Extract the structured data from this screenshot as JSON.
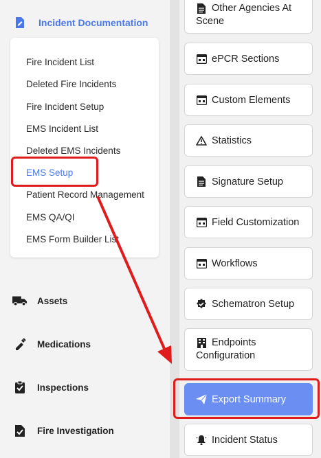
{
  "sidebar": {
    "section": {
      "label": "Incident Documentation",
      "icon": "file-edit-icon"
    },
    "submenu": [
      {
        "label": "Fire Incident List"
      },
      {
        "label": "Deleted Fire Incidents"
      },
      {
        "label": "Fire Incident Setup"
      },
      {
        "label": "EMS Incident List"
      },
      {
        "label": "Deleted EMS Incidents"
      },
      {
        "label": "EMS Setup",
        "active": true
      },
      {
        "label": "Patient Record Management"
      },
      {
        "label": "EMS QA/QI"
      },
      {
        "label": "EMS Form Builder List"
      }
    ],
    "nav": [
      {
        "label": "Assets",
        "icon": "truck-icon"
      },
      {
        "label": "Medications",
        "icon": "syringe-icon"
      },
      {
        "label": "Inspections",
        "icon": "clipboard-check-icon"
      },
      {
        "label": "Fire Investigation",
        "icon": "file-search-icon"
      }
    ]
  },
  "cards": [
    {
      "label_line1": "Other Agencies At",
      "label_line2": "Scene",
      "icon": "document-icon"
    },
    {
      "label": "ePCR Sections",
      "icon": "form-icon"
    },
    {
      "label": "Custom Elements",
      "icon": "form-icon"
    },
    {
      "label": "Statistics",
      "icon": "warning-icon"
    },
    {
      "label": "Signature Setup",
      "icon": "document-icon"
    },
    {
      "label": "Field Customization",
      "icon": "form-icon"
    },
    {
      "label": "Workflows",
      "icon": "form-icon"
    },
    {
      "label": "Schematron Setup",
      "icon": "badge-check-icon"
    },
    {
      "label_line1": "Endpoints",
      "label_line2": "Configuration",
      "icon": "building-icon"
    },
    {
      "label": "Export Summary",
      "icon": "send-icon",
      "primary": true
    },
    {
      "label": "Incident Status",
      "icon": "bell-icon"
    }
  ],
  "colors": {
    "accent": "#4a78e8",
    "primary_button": "#6a8ef2",
    "highlight": "#e01b1b"
  }
}
